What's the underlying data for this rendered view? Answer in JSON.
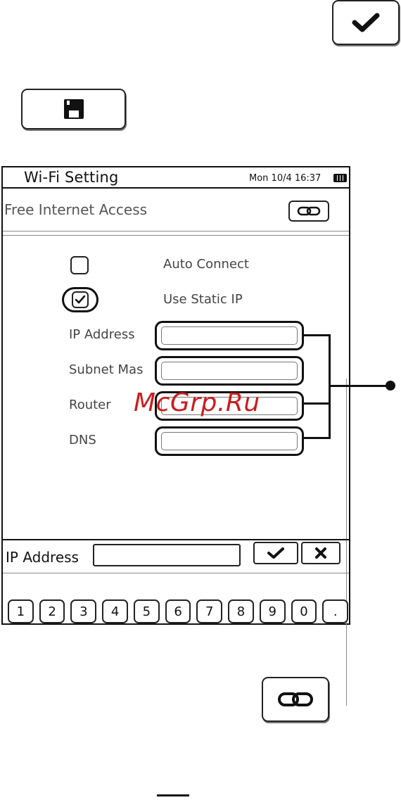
{
  "device": {
    "title": "Wi-Fi Setting",
    "clock": "Mon 10/4 16:37",
    "ssid": "Free Internet Access",
    "options": {
      "auto_connect": "Auto Connect",
      "use_static_ip": "Use Static IP"
    },
    "fields": [
      {
        "label": "IP Address",
        "value": ""
      },
      {
        "label": "Subnet Mas",
        "value": ""
      },
      {
        "label": "Router",
        "value": ""
      },
      {
        "label": "DNS",
        "value": ""
      }
    ],
    "entry": {
      "label": "IP Address",
      "value": ""
    },
    "keypad": [
      "1",
      "2",
      "3",
      "4",
      "5",
      "6",
      "7",
      "8",
      "9",
      "0",
      "."
    ]
  },
  "watermark": "McGrp.Ru",
  "icons": {
    "top_right": "checkmark-icon",
    "top_left": "save-icon",
    "bottom": "link-icon"
  },
  "colors": {
    "watermark": "#c81e1e",
    "ink": "#111111"
  }
}
